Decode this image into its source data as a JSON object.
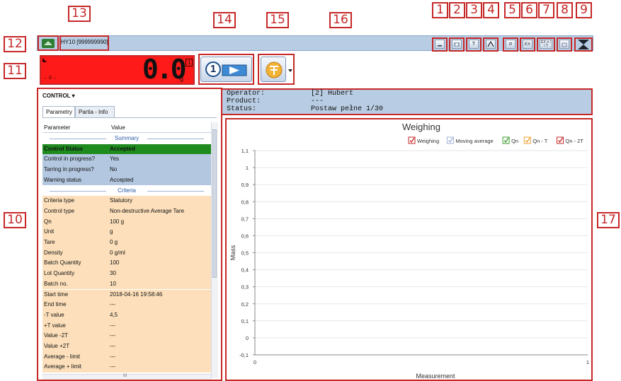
{
  "callouts": [
    "1",
    "2",
    "3",
    "4",
    "5",
    "6",
    "7",
    "8",
    "9",
    "10",
    "11",
    "12",
    "13",
    "14",
    "15",
    "16",
    "17"
  ],
  "toolbar": {
    "device_label": "HY10 [999999990]",
    "icons": [
      "minimize-window-icon",
      "camera-icon",
      "tare-icon",
      "peak-icon",
      "sigma-icon",
      "ex-icon",
      "ex-sigma-icon",
      "restore-window-icon",
      "close-window-icon"
    ],
    "icon_glyphs": {
      "tare": "T",
      "peak": "/\\",
      "sigma": "σ",
      "ex": "EX",
      "exsigma": "EX σ / \\ T"
    }
  },
  "weighing": {
    "value": "0.0",
    "unit": "g",
    "zero_mark": "→ 0 ←",
    "range_mark": "1",
    "stable_mark": "◣"
  },
  "buttons": {
    "start_number": "1"
  },
  "control": {
    "title": "CONTROL",
    "tabs": [
      "Parametry",
      "Partia - Info"
    ],
    "header": {
      "parameter": "Parameter",
      "value": "Value"
    },
    "summary_label": "Summary",
    "criteria_label": "Criteria",
    "summary_rows": [
      {
        "p": "Control Status",
        "v": "Accepted"
      },
      {
        "p": "Control in progress?",
        "v": "Yes"
      },
      {
        "p": "Tarring in progress?",
        "v": "No"
      },
      {
        "p": "Warning status",
        "v": "Accepted"
      }
    ],
    "criteria_rows": [
      {
        "p": "Criteria type",
        "v": "Statutory"
      },
      {
        "p": "Control type",
        "v": "Non-destructive Average Tare"
      },
      {
        "p": "Qn",
        "v": "100 g"
      },
      {
        "p": "Unit",
        "v": "g"
      },
      {
        "p": "Tare",
        "v": "0 g"
      },
      {
        "p": "Density",
        "v": "0 g/ml"
      },
      {
        "p": "Batch Quantity",
        "v": "100"
      },
      {
        "p": "Lot Quantity",
        "v": "30"
      },
      {
        "p": "Batch no.",
        "v": "10"
      },
      {
        "p": "Start time",
        "v": "2018-04-16 19:58:46"
      },
      {
        "p": "End time",
        "v": "---"
      },
      {
        "p": "-T value",
        "v": "4,5"
      },
      {
        "p": "+T value",
        "v": "---"
      },
      {
        "p": "Value -2T",
        "v": "---"
      },
      {
        "p": "Value +2T",
        "v": "---"
      },
      {
        "p": "Average - limit",
        "v": "---"
      },
      {
        "p": "Average + limit",
        "v": "---"
      }
    ],
    "scroll_marker": "III"
  },
  "info": {
    "operator_label": "Operator:",
    "operator_value": "[2] Hubert",
    "product_label": "Product:",
    "product_value": "---",
    "status_label": "Status:",
    "status_value": "Postaw pełne 1/30"
  },
  "chart_data": {
    "type": "line",
    "title": "Weighing",
    "xlabel": "Measurement",
    "ylabel": "Mass",
    "ylim": [
      -0.1,
      1.1
    ],
    "xlim": [
      0,
      1
    ],
    "yticks": [
      "1,1",
      "1",
      "0,9",
      "0,8",
      "0,7",
      "0,6",
      "0,5",
      "0,4",
      "0,3",
      "0,2",
      "0,1",
      "0",
      "-0,1"
    ],
    "xticks": [
      "0",
      "1"
    ],
    "legend": [
      {
        "name": "Weighing",
        "checked": true,
        "color": "#c62828"
      },
      {
        "name": "Moving average",
        "checked": true,
        "color": "#9fb0d8"
      },
      {
        "name": "Qn",
        "checked": true,
        "color": "#3c9b2e"
      },
      {
        "name": "Qn - T",
        "checked": true,
        "color": "#f0a030"
      },
      {
        "name": "Qn - 2T",
        "checked": true,
        "color": "#c62828"
      }
    ],
    "legend_position": "top-right",
    "grid": true,
    "series": []
  },
  "colors": {
    "accepted_green": "#1f8b1f",
    "criteria_row": "#fde0bb",
    "summary_row": "#b3c7e0",
    "display_red": "#ff1a1a"
  }
}
